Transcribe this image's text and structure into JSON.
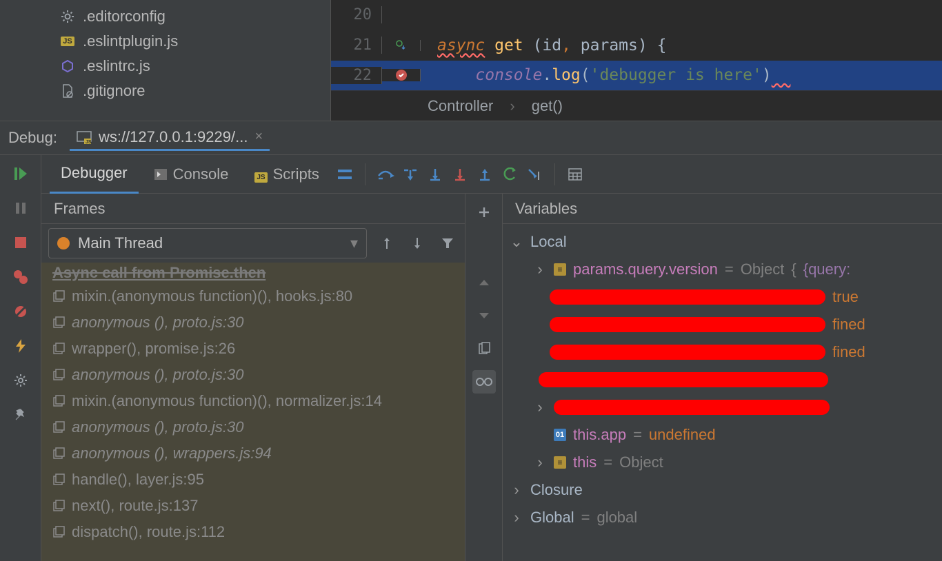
{
  "project_tree": {
    "items": [
      {
        "name": ".editorconfig",
        "icon": "gear"
      },
      {
        "name": ".eslintplugin.js",
        "icon": "js"
      },
      {
        "name": ".eslintrc.js",
        "icon": "hex"
      },
      {
        "name": ".gitignore",
        "icon": "file"
      }
    ]
  },
  "editor": {
    "lines": [
      {
        "num": "20",
        "code": ""
      },
      {
        "num": "21",
        "code_segments": [
          "async",
          " ",
          "get",
          " (",
          "id",
          ", ",
          "params",
          ") {"
        ]
      },
      {
        "num": "22",
        "code_segments": [
          "    ",
          "console",
          ".",
          "log",
          "(",
          "'debugger is here'",
          ")"
        ],
        "hl": true,
        "breakpoint": true
      }
    ],
    "breadcrumb": [
      "Controller",
      "get()"
    ]
  },
  "debug": {
    "title": "Debug:",
    "run_config": "ws://127.0.0.1:9229/...",
    "tabs": [
      "Debugger",
      "Console",
      "Scripts"
    ]
  },
  "frames": {
    "header": "Frames",
    "thread": "Main Thread",
    "async_header": "Async call from Promise.then",
    "items": [
      {
        "fn": "mixin.(anonymous function)()",
        "loc": "hooks.js:80"
      },
      {
        "fn": "anonymous ()",
        "loc": "proto.js:30",
        "italic": true
      },
      {
        "fn": "wrapper()",
        "loc": "promise.js:26"
      },
      {
        "fn": "anonymous ()",
        "loc": "proto.js:30",
        "italic": true
      },
      {
        "fn": "mixin.(anonymous function)()",
        "loc": "normalizer.js:14"
      },
      {
        "fn": "anonymous ()",
        "loc": "proto.js:30",
        "italic": true
      },
      {
        "fn": "anonymous ()",
        "loc": "wrappers.js:94",
        "italic": true
      },
      {
        "fn": "handle()",
        "loc": "layer.js:95"
      },
      {
        "fn": "next()",
        "loc": "route.js:137"
      },
      {
        "fn": "dispatch()",
        "loc": "route.js:112"
      }
    ]
  },
  "variables": {
    "header": "Variables",
    "local_label": "Local",
    "params_name": "params.query.version",
    "params_val": "Object",
    "params_extra": "{query:",
    "redacted_suffixes": [
      "true",
      "fined",
      "fined"
    ],
    "this_app_name": "this.app",
    "this_app_val": "undefined",
    "this_name": "this",
    "this_val": "Object",
    "closure_label": "Closure",
    "global_label": "Global",
    "global_val": "global"
  }
}
